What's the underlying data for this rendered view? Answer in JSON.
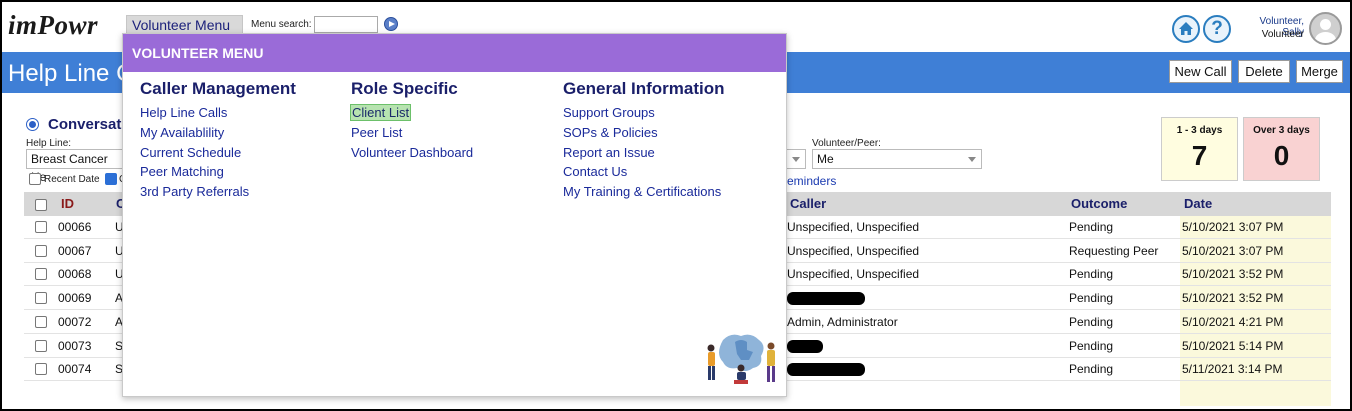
{
  "app": {
    "logo": "imPowr"
  },
  "topbar": {
    "volunteer_menu_label": "Volunteer Menu",
    "menu_search_label": "Menu search:",
    "menu_search_value": "",
    "user_name": "Volunteer, Sally",
    "user_role": "Volunteer"
  },
  "header": {
    "title": "Help Line C",
    "buttons": {
      "new_call": "New Call",
      "delete": "Delete",
      "merge": "Merge"
    }
  },
  "filters": {
    "conversation_label": "Conversati",
    "help_line_label": "Help Line:",
    "help_line_value": "Breast Cancer He",
    "recent_date_label": "Recent Date",
    "second_checkbox_label": "C",
    "volunteer_peer_label": "Volunteer/Peer:",
    "volunteer_peer_value": "Me",
    "reminders_link": "eminders"
  },
  "counters": {
    "one_to_three": {
      "label": "1 - 3 days",
      "value": "7",
      "color": "#fffde0"
    },
    "over_three": {
      "label": "Over 3 days",
      "value": "0",
      "color": "#f9d2d2"
    }
  },
  "table": {
    "headers": {
      "id": "ID",
      "second": "C",
      "caller": "Caller",
      "outcome": "Outcome",
      "date": "Date"
    },
    "rows": [
      {
        "id": "00066",
        "c": "U",
        "caller": "Unspecified, Unspecified",
        "outcome": "Pending",
        "date": "5/10/2021 3:07 PM"
      },
      {
        "id": "00067",
        "c": "U",
        "caller": "Unspecified, Unspecified",
        "outcome": "Requesting Peer",
        "date": "5/10/2021 3:07 PM"
      },
      {
        "id": "00068",
        "c": "U",
        "caller": "Unspecified, Unspecified",
        "outcome": "Pending",
        "date": "5/10/2021 3:52 PM"
      },
      {
        "id": "00069",
        "c": "A",
        "caller": "",
        "outcome": "Pending",
        "date": "5/10/2021 3:52 PM"
      },
      {
        "id": "00072",
        "c": "A",
        "caller": "Admin, Administrator",
        "outcome": "Pending",
        "date": "5/10/2021 4:21 PM"
      },
      {
        "id": "00073",
        "c": "S",
        "caller": "",
        "outcome": "Pending",
        "date": "5/10/2021 5:14 PM"
      },
      {
        "id": "00074",
        "c": "S",
        "caller": "",
        "outcome": "Pending",
        "date": "5/11/2021 3:14 PM"
      }
    ]
  },
  "volunteer_menu": {
    "heading": "VOLUNTEER MENU",
    "columns": [
      {
        "title": "Caller Management",
        "items": [
          "Help Line Calls",
          "My Availablility",
          "Current Schedule",
          "Peer Matching",
          "3rd Party Referrals"
        ]
      },
      {
        "title": "Role Specific",
        "items": [
          "Client List",
          "Peer List",
          "Volunteer Dashboard"
        ]
      },
      {
        "title": "General Information",
        "items": [
          "Support Groups",
          "SOPs & Policies",
          "Report an Issue",
          "Contact Us",
          "My Training & Certifications"
        ]
      }
    ],
    "highlighted_item": "Client List"
  },
  "colors": {
    "header_blue": "#3f7fd6",
    "menu_purple": "#9a6bd8",
    "highlight_green": "#b7e3b0"
  }
}
